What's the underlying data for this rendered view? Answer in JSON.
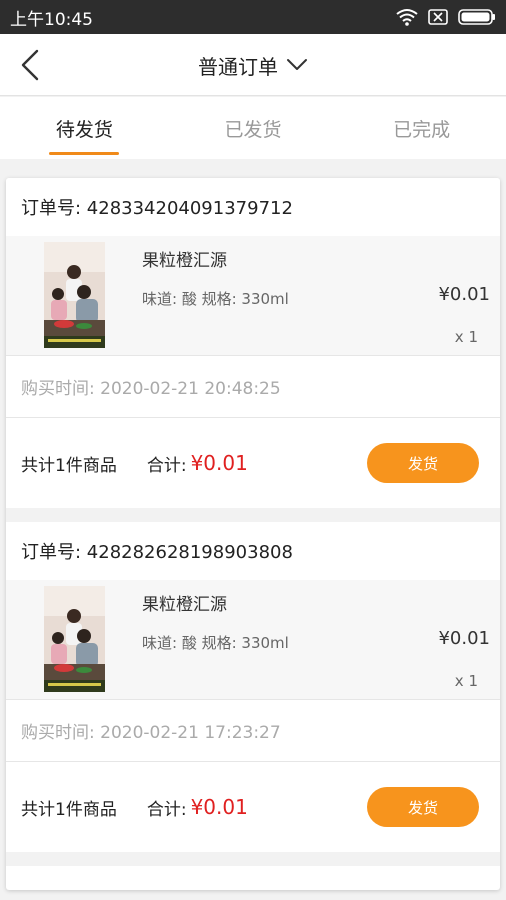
{
  "status_bar": {
    "time": "上午10:45",
    "icons": [
      "wifi-icon",
      "sim-x-icon",
      "battery-icon"
    ]
  },
  "nav": {
    "title": "普通订单",
    "back_icon": "chevron-left-icon",
    "dropdown_icon": "chevron-down-icon"
  },
  "tabs": [
    {
      "label": "待发货",
      "active": true
    },
    {
      "label": "已发货",
      "active": false
    },
    {
      "label": "已完成",
      "active": false
    }
  ],
  "orders": [
    {
      "order_no": "订单号: 428334204091379712",
      "product": {
        "name": "果粒橙汇源",
        "spec": "味道: 酸 规格: 330ml",
        "price": "¥0.01",
        "qty": "x 1"
      },
      "buy_time": "购买时间: 2020-02-21 20:48:25",
      "count_text": "共计1件商品",
      "total_label": "合计:",
      "total": "¥0.01",
      "ship_label": "发货"
    },
    {
      "order_no": "订单号: 428282628198903808",
      "product": {
        "name": "果粒橙汇源",
        "spec": "味道: 酸 规格: 330ml",
        "price": "¥0.01",
        "qty": "x 1"
      },
      "buy_time": "购买时间: 2020-02-21 17:23:27",
      "count_text": "共计1件商品",
      "total_label": "合计:",
      "total": "¥0.01",
      "ship_label": "发货"
    }
  ],
  "colors": {
    "accent": "#f7941d",
    "price_red": "#e02020",
    "status_bar": "#2d2d2d"
  }
}
